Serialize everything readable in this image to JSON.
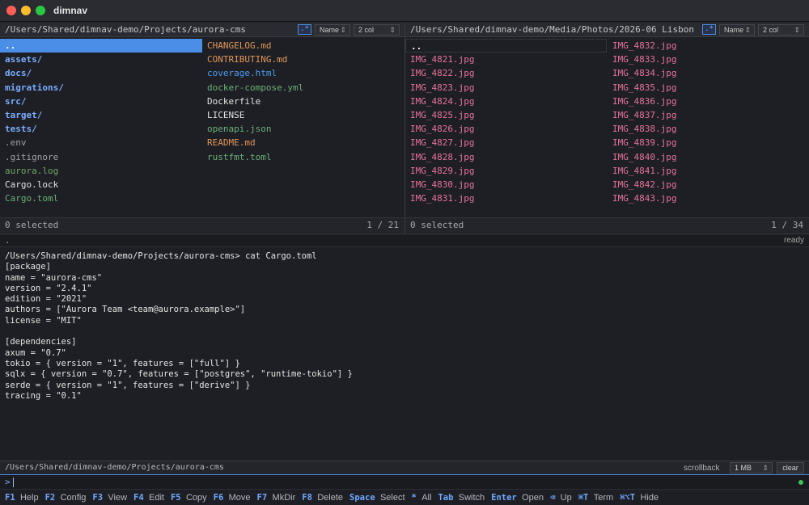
{
  "window": {
    "title": "dimnav"
  },
  "left_pane": {
    "path": "/Users/Shared/dimnav-demo/Projects/aurora-cms",
    "regex_label": ".*",
    "sort_label": "Name",
    "cols_label": "2 col",
    "columns": [
      [
        {
          "name": "..",
          "kind": "dotdot",
          "cursor": true
        },
        {
          "name": "assets/",
          "kind": "dir"
        },
        {
          "name": "docs/",
          "kind": "dir"
        },
        {
          "name": "migrations/",
          "kind": "dir"
        },
        {
          "name": "src/",
          "kind": "dir"
        },
        {
          "name": "target/",
          "kind": "dir"
        },
        {
          "name": "tests/",
          "kind": "dir"
        },
        {
          "name": ".env",
          "kind": "hidden"
        },
        {
          "name": ".gitignore",
          "kind": "hidden"
        },
        {
          "name": "aurora.log",
          "kind": "log"
        },
        {
          "name": "Cargo.lock",
          "kind": "plain"
        },
        {
          "name": "Cargo.toml",
          "kind": "toml"
        }
      ],
      [
        {
          "name": "CHANGELOG.md",
          "kind": "md"
        },
        {
          "name": "CONTRIBUTING.md",
          "kind": "md"
        },
        {
          "name": "coverage.html",
          "kind": "html"
        },
        {
          "name": "docker-compose.yml",
          "kind": "toml"
        },
        {
          "name": "Dockerfile",
          "kind": "plain"
        },
        {
          "name": "LICENSE",
          "kind": "plain"
        },
        {
          "name": "openapi.json",
          "kind": "toml"
        },
        {
          "name": "README.md",
          "kind": "md"
        },
        {
          "name": "rustfmt.toml",
          "kind": "toml"
        }
      ]
    ],
    "selected_text": "0 selected",
    "count_text": "1 / 21"
  },
  "right_pane": {
    "path": "/Users/Shared/dimnav-demo/Media/Photos/2026-06 Lisbon",
    "regex_label": ".*",
    "sort_label": "Name",
    "cols_label": "2 col",
    "columns": [
      [
        {
          "name": "..",
          "kind": "dotdot",
          "cursor": true
        },
        {
          "name": "IMG_4821.jpg",
          "kind": "jpg"
        },
        {
          "name": "IMG_4822.jpg",
          "kind": "jpg"
        },
        {
          "name": "IMG_4823.jpg",
          "kind": "jpg"
        },
        {
          "name": "IMG_4824.jpg",
          "kind": "jpg"
        },
        {
          "name": "IMG_4825.jpg",
          "kind": "jpg"
        },
        {
          "name": "IMG_4826.jpg",
          "kind": "jpg"
        },
        {
          "name": "IMG_4827.jpg",
          "kind": "jpg"
        },
        {
          "name": "IMG_4828.jpg",
          "kind": "jpg"
        },
        {
          "name": "IMG_4829.jpg",
          "kind": "jpg"
        },
        {
          "name": "IMG_4830.jpg",
          "kind": "jpg"
        },
        {
          "name": "IMG_4831.jpg",
          "kind": "jpg"
        }
      ],
      [
        {
          "name": "IMG_4832.jpg",
          "kind": "jpg"
        },
        {
          "name": "IMG_4833.jpg",
          "kind": "jpg"
        },
        {
          "name": "IMG_4834.jpg",
          "kind": "jpg"
        },
        {
          "name": "IMG_4835.jpg",
          "kind": "jpg"
        },
        {
          "name": "IMG_4836.jpg",
          "kind": "jpg"
        },
        {
          "name": "IMG_4837.jpg",
          "kind": "jpg"
        },
        {
          "name": "IMG_4838.jpg",
          "kind": "jpg"
        },
        {
          "name": "IMG_4839.jpg",
          "kind": "jpg"
        },
        {
          "name": "IMG_4840.jpg",
          "kind": "jpg"
        },
        {
          "name": "IMG_4841.jpg",
          "kind": "jpg"
        },
        {
          "name": "IMG_4842.jpg",
          "kind": "jpg"
        },
        {
          "name": "IMG_4843.jpg",
          "kind": "jpg"
        }
      ]
    ],
    "selected_text": "0 selected",
    "count_text": "1 / 34"
  },
  "terminal": {
    "header_path": ".",
    "status": "ready",
    "lines": [
      "/Users/Shared/dimnav-demo/Projects/aurora-cms> cat Cargo.toml",
      "[package]",
      "name = \"aurora-cms\"",
      "version = \"2.4.1\"",
      "edition = \"2021\"",
      "authors = [\"Aurora Team <team@aurora.example>\"]",
      "license = \"MIT\"",
      "",
      "[dependencies]",
      "axum = \"0.7\"",
      "tokio = { version = \"1\", features = [\"full\"] }",
      "sqlx = { version = \"0.7\", features = [\"postgres\", \"runtime-tokio\"] }",
      "serde = { version = \"1\", features = [\"derive\"] }",
      "tracing = \"0.1\""
    ],
    "footer_path": "/Users/Shared/dimnav-demo/Projects/aurora-cms",
    "scrollback_label": "scrollback",
    "scrollback_value": "1 MB",
    "clear_label": "clear"
  },
  "command_line": {
    "prompt": ">",
    "value": ""
  },
  "fkeys": [
    {
      "key": "F1",
      "label": "Help"
    },
    {
      "key": "F2",
      "label": "Config"
    },
    {
      "key": "F3",
      "label": "View"
    },
    {
      "key": "F4",
      "label": "Edit"
    },
    {
      "key": "F5",
      "label": "Copy"
    },
    {
      "key": "F6",
      "label": "Move"
    },
    {
      "key": "F7",
      "label": "MkDir"
    },
    {
      "key": "F8",
      "label": "Delete"
    },
    {
      "key": "Space",
      "label": "Select"
    },
    {
      "key": "*",
      "label": "All"
    },
    {
      "key": "Tab",
      "label": "Switch"
    },
    {
      "key": "Enter",
      "label": "Open"
    },
    {
      "key": "⌫",
      "label": "Up"
    },
    {
      "key": "⌘T",
      "label": "Term"
    },
    {
      "key": "⌘⌥T",
      "label": "Hide"
    }
  ],
  "colors": {
    "accent": "#4a8ee8",
    "dir": "#79adff",
    "jpg": "#e5739a",
    "md": "#e0965a",
    "toml": "#6bb07a",
    "status_ok": "#3cc45a"
  }
}
